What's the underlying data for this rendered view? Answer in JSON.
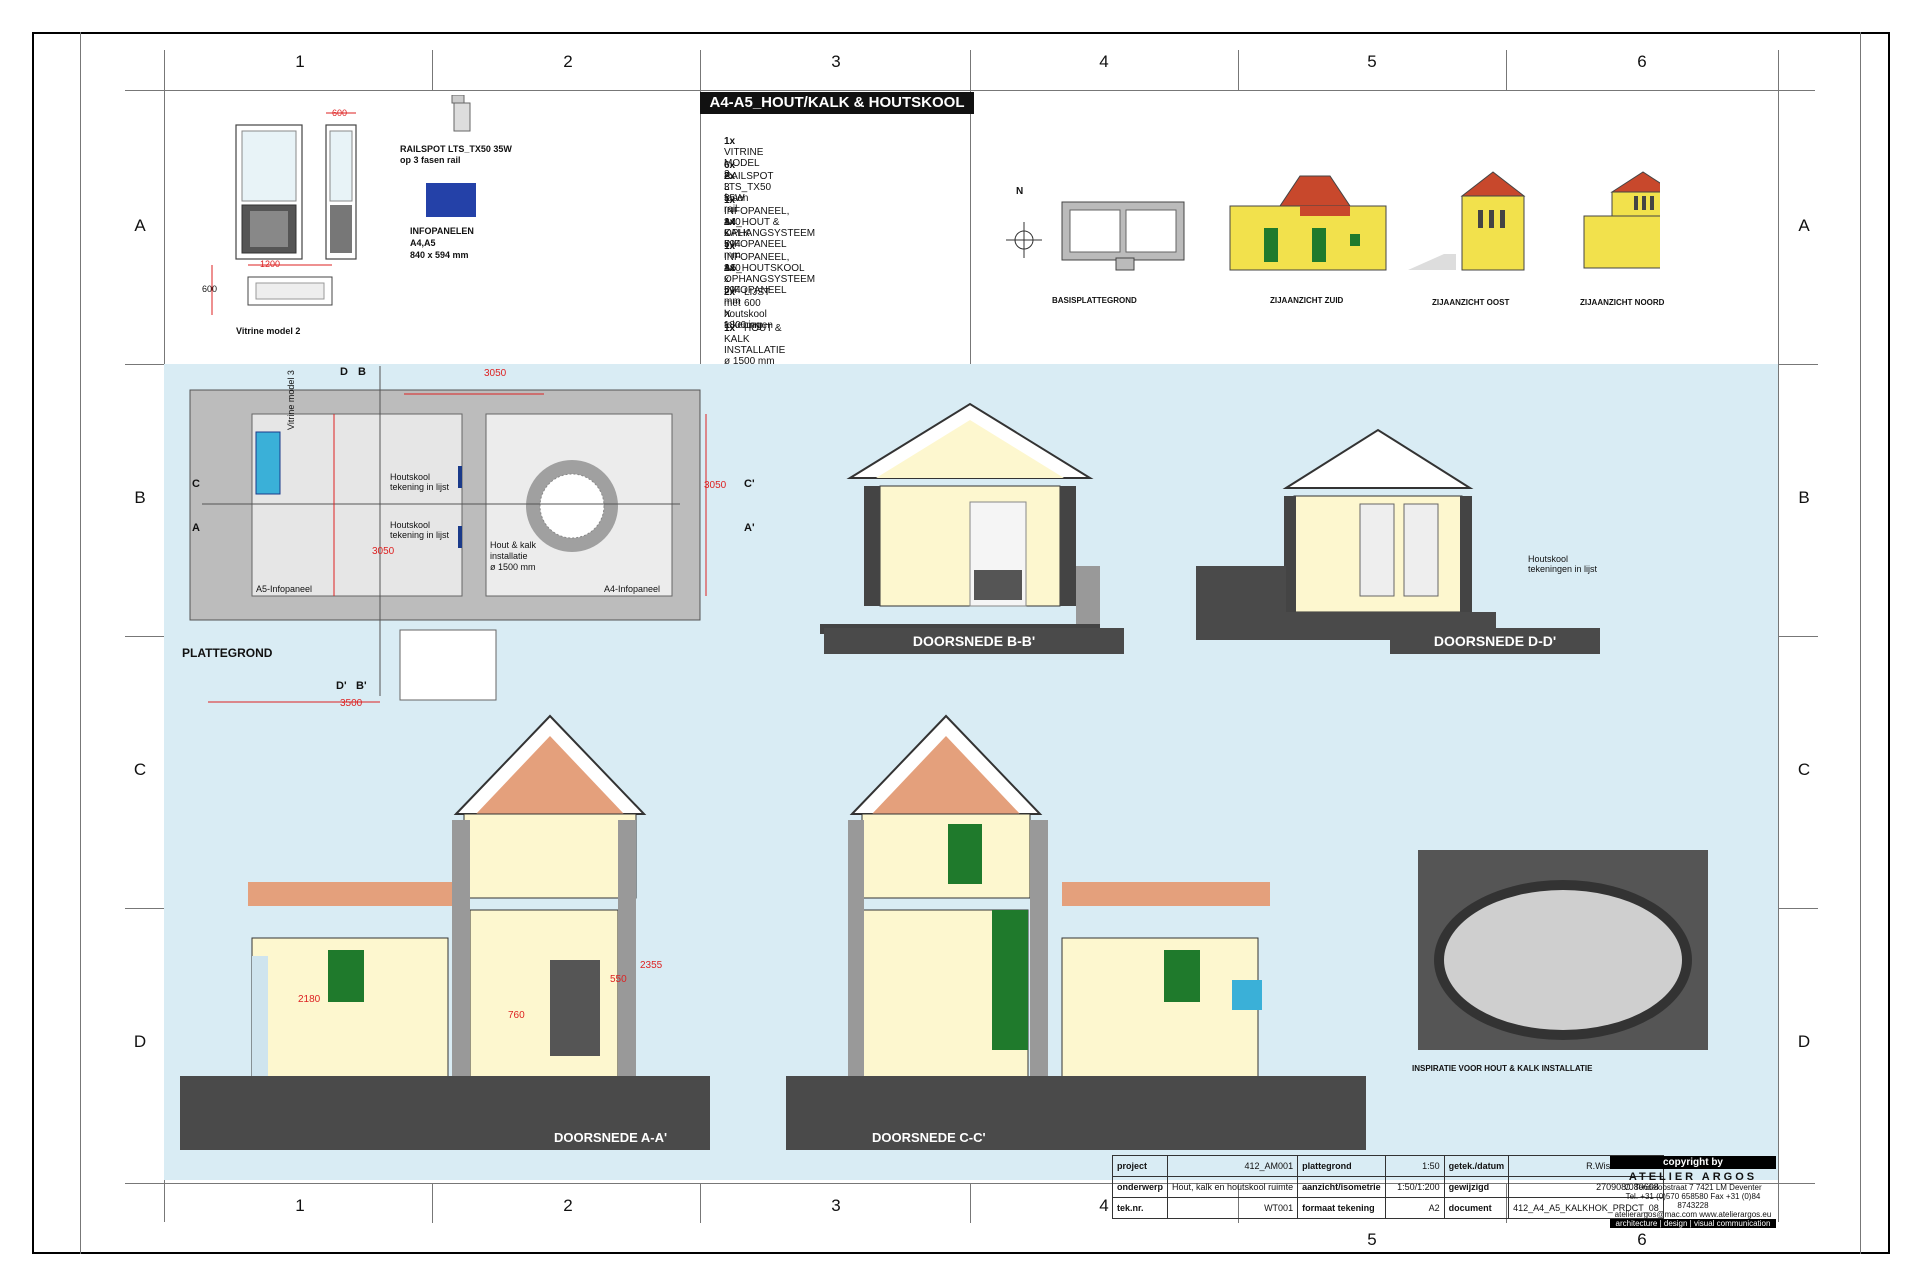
{
  "grid": {
    "columns": [
      "1",
      "2",
      "3",
      "4",
      "5",
      "6"
    ],
    "rows": [
      "A",
      "B",
      "C",
      "D"
    ]
  },
  "sheet_title": "A4-A5_HOUT/KALK & HOUTSKOOL",
  "top_left": {
    "dim_600": "600",
    "dim_1200": "1200",
    "dim_600_side": "600",
    "railspot_l1": "RAILSPOT LTS_TX50 35W",
    "railspot_l2": "op 3 fasen rail",
    "infopanelen_l1": "INFOPANELEN",
    "infopanelen_l2": "A4,A5",
    "infopanelen_l3": "840 x 594 mm",
    "vitrine_caption": "Vitrine model 2"
  },
  "item_list": [
    {
      "qty": "1x",
      "text": "VITRINE MODEL 2"
    },
    {
      "qty": "6x",
      "text": "RAILSPOT LTS_TX50 35W"
    },
    {
      "qty": "2x",
      "text": "3 fasen rail"
    },
    {
      "qty": "1x",
      "text": "INFOPANEEL, A4_HOUT & KALK"
    },
    {
      "qty": "",
      "text": "840 x 594 mm"
    },
    {
      "qty": "1x",
      "text": "OPHANGSYSTEEM INFOPANEEL"
    },
    {
      "qty": "1x",
      "text": "INFOPANEEL, A5_HOUTSKOOL"
    },
    {
      "qty": "",
      "text": "840 x 594 mm"
    },
    {
      "qty": "1x",
      "text": "OPHANGSYSTEEM INFOPANEEL"
    },
    {
      "qty": "2x",
      "text": "LIJST met houtskool tekeningen"
    },
    {
      "qty": "",
      "text": "600 X 1800mm"
    },
    {
      "qty": "1x",
      "text": "HOUT & KALK INSTALLATIE ø 1500 mm"
    }
  ],
  "top_right": {
    "north": "N",
    "basis": "BASISPLATTEGROND",
    "zuid": "ZIJAANZICHT ZUID",
    "oost": "ZIJAANZICHT OOST",
    "noord": "ZIJAANZICHT NOORD"
  },
  "plan": {
    "title": "PLATTEGROND",
    "dim_top": "3050",
    "dim_right": "3050",
    "dim_left": "3050",
    "dim_bottom": "3500",
    "sec_D": "D",
    "sec_B": "B",
    "sec_D2": "D'",
    "sec_B2": "B'",
    "sec_C": "C",
    "sec_A": "A",
    "sec_C2": "C'",
    "sec_A2": "A'",
    "vitrine": "Vitrine model 3",
    "houtskool1_l1": "Houtskool",
    "houtskool1_l2": "tekening in lijst",
    "houtskool2_l1": "Houtskool",
    "houtskool2_l2": "tekening in lijst",
    "install_l1": "Hout & kalk",
    "install_l2": "installatie",
    "install_l3": "ø 1500 mm",
    "a5": "A5-Infopaneel",
    "a4": "A4-Infopaneel"
  },
  "sections": {
    "bb": "DOORSNEDE B-B'",
    "dd": "DOORSNEDE D-D'",
    "dd_note_l1": "Houtskool",
    "dd_note_l2": "tekeningen in lijst",
    "aa": "DOORSNEDE A-A'",
    "cc": "DOORSNEDE C-C'",
    "aa_2180": "2180",
    "aa_2355": "2355",
    "aa_550": "550",
    "aa_760": "760",
    "photo_caption": "INSPIRATIE VOOR HOUT & KALK INSTALLATIE"
  },
  "titleblock": {
    "rows": [
      [
        "project",
        "412_AM001",
        "plattegrond",
        "1:50",
        "getek./datum",
        "R.Wissink/260807"
      ],
      [
        "onderwerp",
        "Hout, kalk en houtskool ruimte",
        "aanzicht/isometrie",
        "1:50/1:200",
        "gewijzigd",
        "270908/080608"
      ],
      [
        "tek.nr.",
        "WT001",
        "formaat tekening",
        "A2",
        "document",
        "412_A4_A5_KALKHOK_PRDCT_08"
      ]
    ],
    "copyright": "copyright by",
    "firm": "ATELIER ARGOS",
    "addr": "C. Tendeloostraat 7  7421 LM  Deventer",
    "tel": "Tel. +31 (0)570 658580    Fax +31 (0)84 8743228",
    "web": "atelierargos@mac.com    www.atelierargos.eu",
    "tag": "architecture | design | visual communication"
  },
  "colors": {
    "wall_fill": "#bcbcbc",
    "sky_blue": "#d9ecf4",
    "cream": "#fdf7cf",
    "roof_tile": "#e4a07c",
    "yellow_house": "#f2e14c",
    "green_shutter": "#1f7a2c",
    "info_blue": "#2441a8",
    "ground": "#4a4a4a"
  }
}
